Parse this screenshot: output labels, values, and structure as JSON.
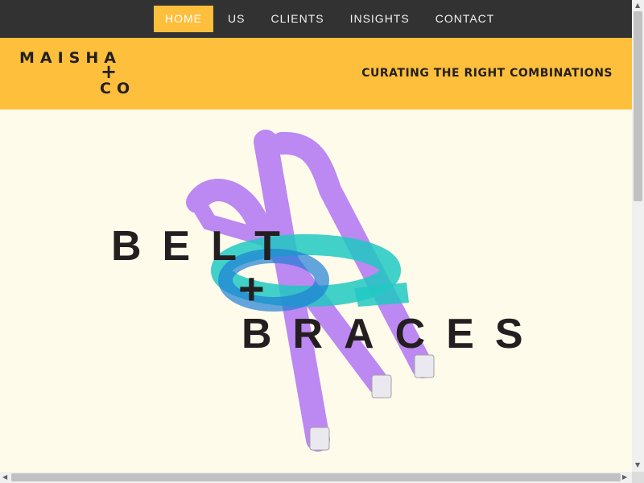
{
  "nav": {
    "items": [
      {
        "label": "HOME",
        "active": true
      },
      {
        "label": "US",
        "active": false
      },
      {
        "label": "CLIENTS",
        "active": false
      },
      {
        "label": "INSIGHTS",
        "active": false
      },
      {
        "label": "CONTACT",
        "active": false
      }
    ]
  },
  "brand": {
    "logo_line1": "MAISHA",
    "logo_plus": "+",
    "logo_line3": "CO",
    "tagline": "CURATING THE RIGHT COMBINATIONS"
  },
  "hero": {
    "line1": "BELT",
    "plus": "+",
    "line2": "BRACES"
  },
  "colors": {
    "nav_bg": "#333232",
    "accent": "#fdbf3c",
    "page_bg": "#fffbea",
    "text_dark": "#231f20",
    "braces": "#b57cf2",
    "belt": "#20c9c2"
  },
  "icons": {
    "scroll_up": "scroll-up-arrow-icon",
    "scroll_down": "scroll-down-arrow-icon",
    "scroll_left": "scroll-left-arrow-icon",
    "scroll_right": "scroll-right-arrow-icon"
  }
}
